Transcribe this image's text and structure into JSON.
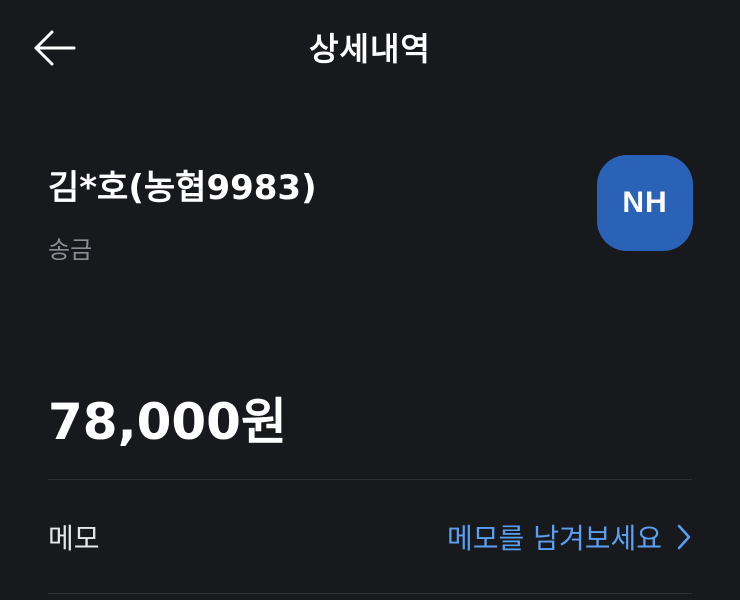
{
  "header": {
    "title": "상세내역",
    "back_icon": "arrow-left-icon"
  },
  "recipient": {
    "name": "김*호(농협9983)",
    "type": "송금",
    "bank_logo_text": "NH",
    "bank_logo_color": "#2a62b8"
  },
  "transaction": {
    "amount": "78,000원"
  },
  "memo": {
    "label": "메모",
    "action_text": "메모를 남겨보세요",
    "action_color": "#5aa0f2",
    "action_icon": "chevron-right-icon"
  },
  "colors": {
    "background": "#18191d",
    "primary_text": "#ffffff",
    "secondary_text": "#8b8e96",
    "divider": "#2e3036"
  }
}
